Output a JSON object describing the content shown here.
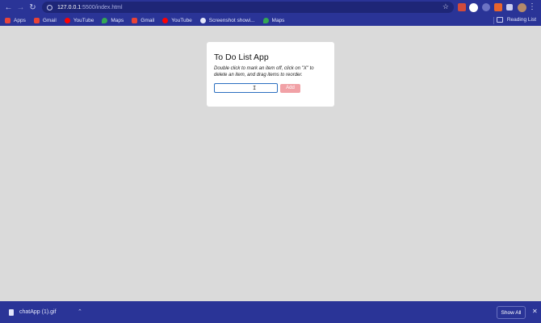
{
  "browser": {
    "url_host": "127.0.0.1",
    "url_path": ":5500/index.html",
    "icons": {
      "back": "back-arrow-icon",
      "forward": "forward-arrow-icon",
      "reload": "reload-icon",
      "star": "bookmark-star-icon",
      "menu": "kebab-menu-icon"
    }
  },
  "bookmarks": {
    "items": [
      {
        "label": "Apps",
        "icon": "apps-grid-icon",
        "color": "#e8453c"
      },
      {
        "label": "Gmail",
        "icon": "gmail-icon",
        "color": "#ea4335"
      },
      {
        "label": "YouTube",
        "icon": "youtube-icon",
        "color": "#ff0000"
      },
      {
        "label": "Maps",
        "icon": "maps-icon",
        "color": "#34a853"
      },
      {
        "label": "Gmail",
        "icon": "gmail-icon",
        "color": "#ea4335"
      },
      {
        "label": "YouTube",
        "icon": "youtube-icon",
        "color": "#ff0000"
      },
      {
        "label": "Screenshot showi...",
        "icon": "globe-icon",
        "color": "#e3e6fa"
      },
      {
        "label": "Maps",
        "icon": "maps-icon",
        "color": "#34a853"
      }
    ],
    "reading_list": "Reading List"
  },
  "app": {
    "title": "To Do List App",
    "instructions": "Double click to mark an item off, click on \"X\" to delete an item, and drag items to reorder.",
    "input_value": "",
    "add_label": "Add",
    "add_color": "#f1a1a6"
  },
  "downloads": {
    "file_name": "chatApp (1).gif",
    "show_all": "Show All"
  },
  "colors": {
    "chrome": "#2a3497",
    "page_bg": "#dadada"
  }
}
